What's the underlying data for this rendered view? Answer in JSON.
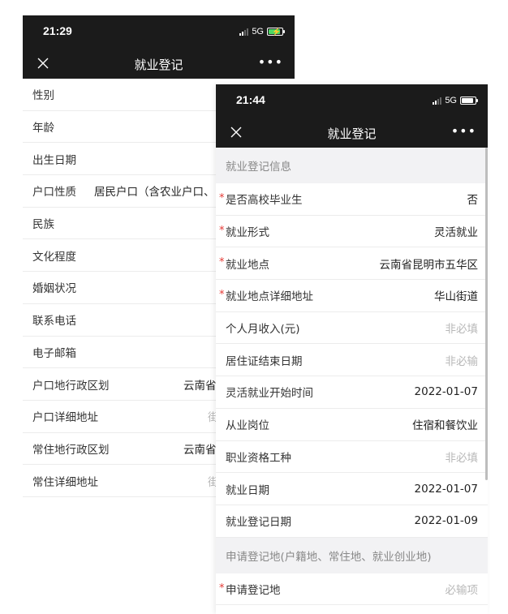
{
  "back": {
    "status": {
      "time": "21:29",
      "network": "5G"
    },
    "nav": {
      "title": "就业登记"
    },
    "rows": [
      {
        "label": "性别",
        "value": ""
      },
      {
        "label": "年龄",
        "value": ""
      },
      {
        "label": "出生日期",
        "value": ""
      },
      {
        "label": "户口性质",
        "value": "居民户口（含农业户口、"
      },
      {
        "label": "民族",
        "value": ""
      },
      {
        "label": "文化程度",
        "value": ""
      },
      {
        "label": "婚姻状况",
        "value": ""
      },
      {
        "label": "联系电话",
        "value": ""
      },
      {
        "label": "电子邮箱",
        "value": ""
      },
      {
        "label": "户口地行政区划",
        "value": "云南省"
      },
      {
        "label": "户口详细地址",
        "value": "街"
      },
      {
        "label": "常住地行政区划",
        "value": "云南省"
      },
      {
        "label": "常住详细地址",
        "value": "街"
      }
    ]
  },
  "front": {
    "status": {
      "time": "21:44",
      "network": "5G"
    },
    "nav": {
      "title": "就业登记"
    },
    "section1": "就业登记信息",
    "rows": [
      {
        "label": "是否高校毕业生",
        "value": "否",
        "required": true,
        "placeholder": false
      },
      {
        "label": "就业形式",
        "value": "灵活就业",
        "required": true,
        "placeholder": false
      },
      {
        "label": "就业地点",
        "value": "云南省昆明市五华区",
        "required": true,
        "placeholder": false
      },
      {
        "label": "就业地点详细地址",
        "value": "华山街道",
        "required": true,
        "placeholder": false
      },
      {
        "label": "个人月收入(元)",
        "value": "非必填",
        "required": false,
        "placeholder": true
      },
      {
        "label": "居住证结束日期",
        "value": "非必输",
        "required": false,
        "placeholder": true
      },
      {
        "label": "灵活就业开始时间",
        "value": "2022-01-07",
        "required": false,
        "placeholder": false
      },
      {
        "label": "从业岗位",
        "value": "住宿和餐饮业",
        "required": false,
        "placeholder": false
      },
      {
        "label": "职业资格工种",
        "value": "非必填",
        "required": false,
        "placeholder": true
      },
      {
        "label": "就业日期",
        "value": "2022-01-07",
        "required": false,
        "placeholder": false
      },
      {
        "label": "就业登记日期",
        "value": "2022-01-09",
        "required": false,
        "placeholder": false
      }
    ],
    "section2": "申请登记地(户籍地、常住地、就业创业地)",
    "apply_row": {
      "label": "申请登记地",
      "value": "必输项",
      "required": true,
      "placeholder": true
    },
    "required_mark": "*"
  },
  "icons": {
    "close": "close-icon",
    "more": "more-icon",
    "signal": "signal-icon",
    "battery": "battery-icon"
  },
  "colors": {
    "navbar": "#1b1b1b",
    "required": "#e53935",
    "placeholder": "#b8b8b8",
    "section_bg": "#f2f2f4",
    "charging": "#4cd964"
  },
  "battery": {
    "back_level": 0.9,
    "back_charging": true,
    "front_level": 0.85
  }
}
